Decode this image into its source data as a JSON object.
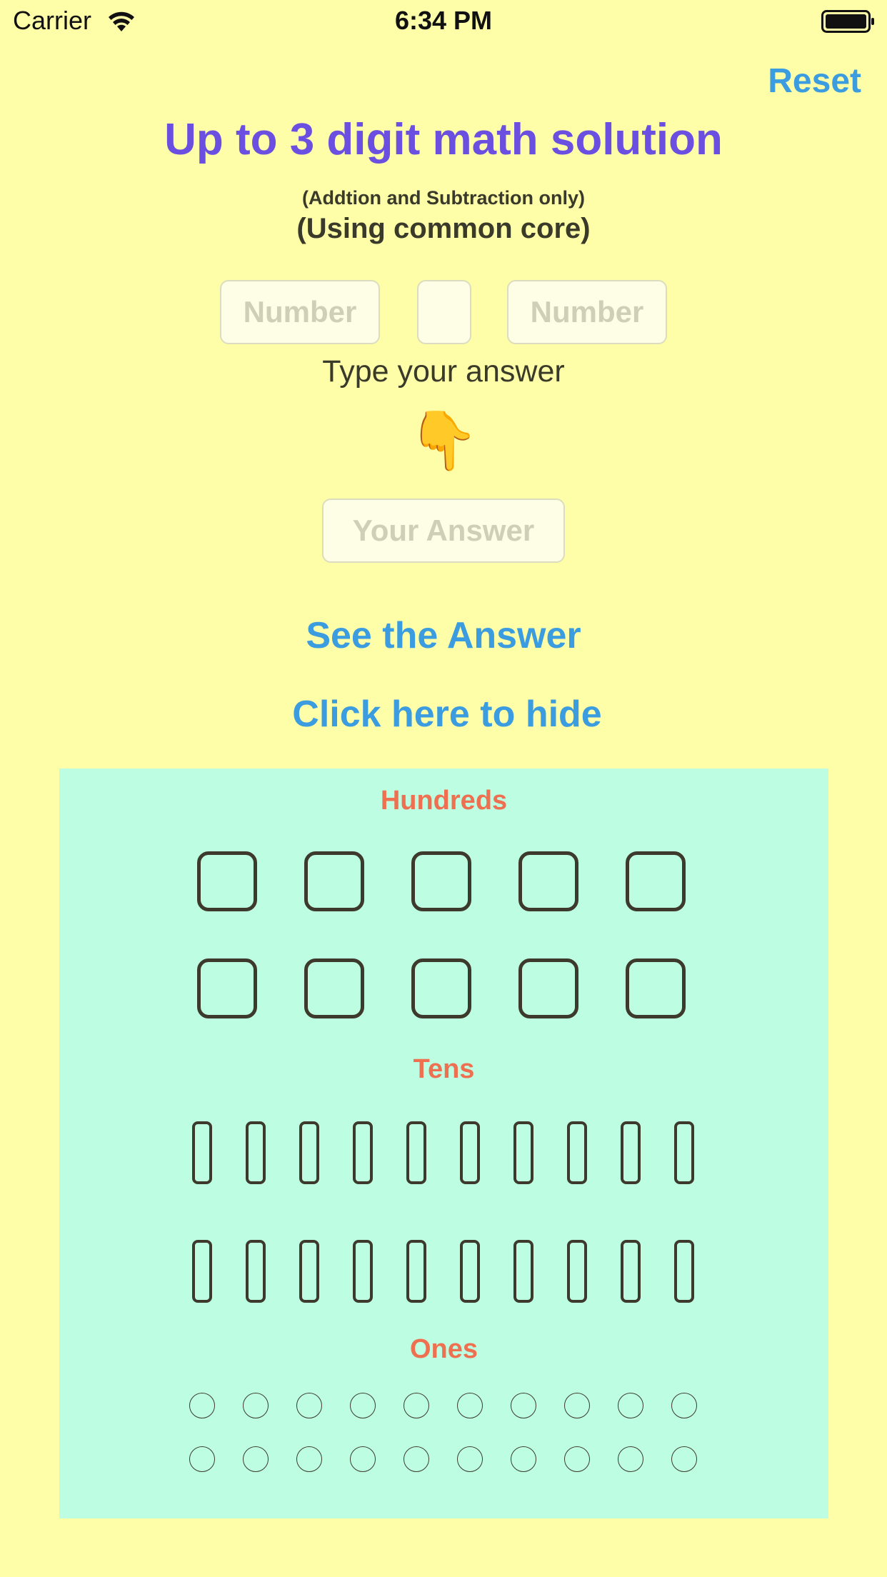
{
  "status_bar": {
    "carrier": "Carrier",
    "time": "6:34 PM"
  },
  "header": {
    "reset_label": "Reset"
  },
  "title": "Up to 3 digit math solution",
  "subtitle_1": "(Addtion and Subtraction only)",
  "subtitle_2": "(Using common core)",
  "inputs": {
    "number_1_placeholder": "Number",
    "operator_value": "",
    "number_2_placeholder": "Number",
    "answer_placeholder": "Your Answer"
  },
  "prompt": "Type your answer",
  "pointer_emoji": "👇",
  "buttons": {
    "see_answer": "See the Answer",
    "hide": "Click here to hide"
  },
  "panel": {
    "hundreds_label": "Hundreds",
    "tens_label": "Tens",
    "ones_label": "Ones",
    "hundreds_count": 10,
    "tens_count": 20,
    "ones_count": 20
  },
  "colors": {
    "background": "#fffea8",
    "panel": "#bdfee2",
    "title": "#6b4fe0",
    "link": "#3b9cdf",
    "section_label": "#ee7050"
  }
}
